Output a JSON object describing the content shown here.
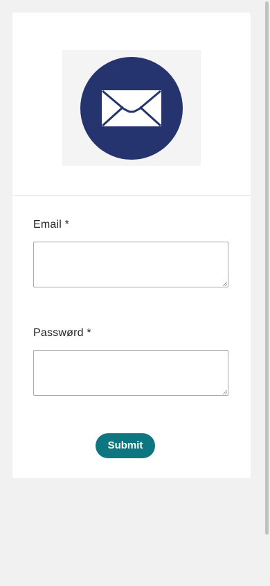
{
  "form": {
    "email": {
      "label": "Email *",
      "value": ""
    },
    "password": {
      "label": "Passwørd *",
      "value": ""
    },
    "submit_label": "Submit"
  },
  "logo": {
    "icon": "envelope-icon",
    "circle_color": "#25346e",
    "background_color": "#f4f4f4"
  },
  "colors": {
    "accent": "#0d7680",
    "page_background": "#f1f1f1",
    "card_background": "#ffffff"
  }
}
